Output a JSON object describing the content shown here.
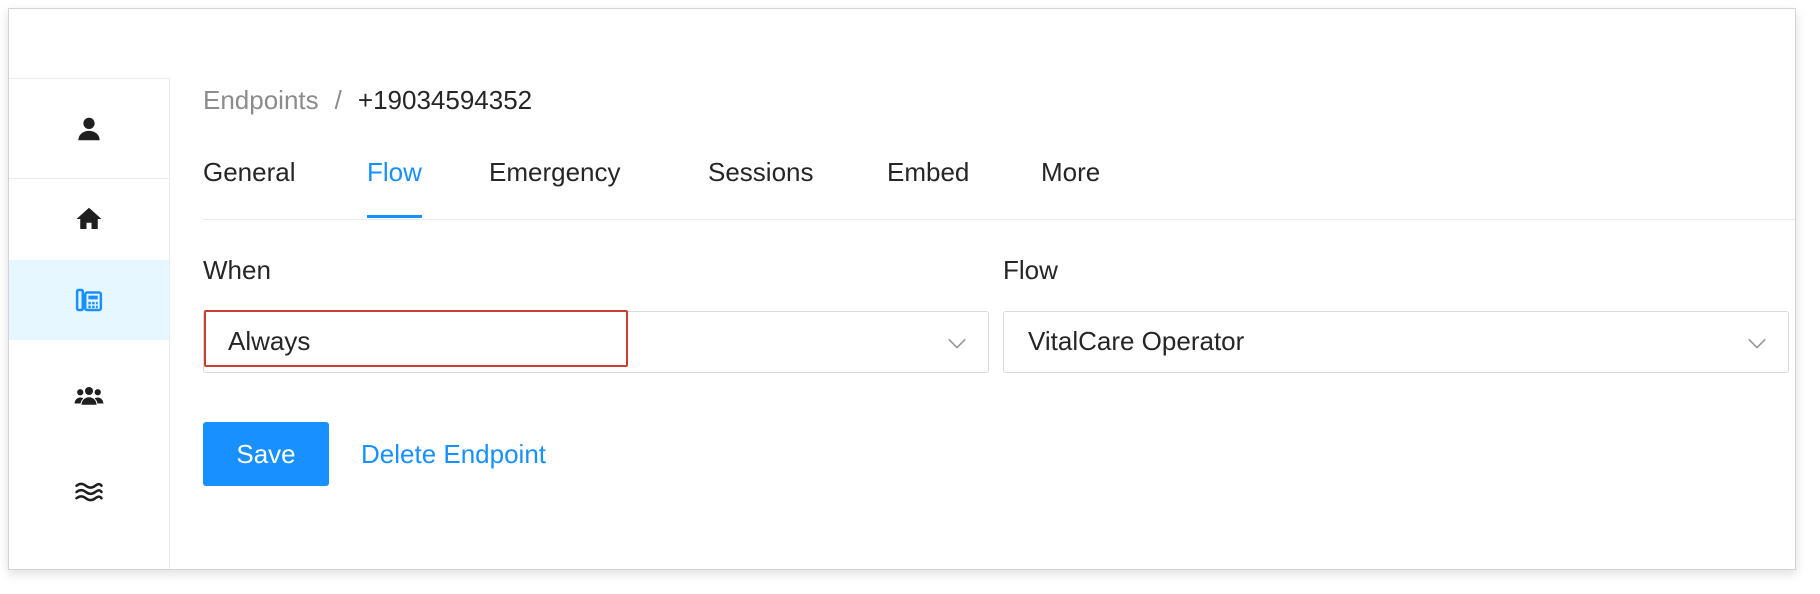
{
  "sidebar": {
    "items": [
      {
        "icon": "user-icon"
      },
      {
        "icon": "home-icon"
      },
      {
        "icon": "phone-endpoint-icon",
        "active": true
      },
      {
        "icon": "users-icon"
      },
      {
        "icon": "waves-icon"
      }
    ]
  },
  "breadcrumb": {
    "parent": "Endpoints",
    "separator": "/",
    "current": "+19034594352"
  },
  "tabs": [
    {
      "label": "General"
    },
    {
      "label": "Flow",
      "active": true
    },
    {
      "label": "Emergency"
    },
    {
      "label": "Sessions"
    },
    {
      "label": "Embed"
    },
    {
      "label": "More"
    }
  ],
  "form": {
    "when_label": "When",
    "when_value": "Always",
    "flow_label": "Flow",
    "flow_value": "VitalCare Operator"
  },
  "actions": {
    "save_label": "Save",
    "delete_label": "Delete Endpoint"
  },
  "colors": {
    "accent": "#1890ff",
    "active_sidebar_bg": "#e6f7ff",
    "highlight_border": "#c9402e"
  }
}
